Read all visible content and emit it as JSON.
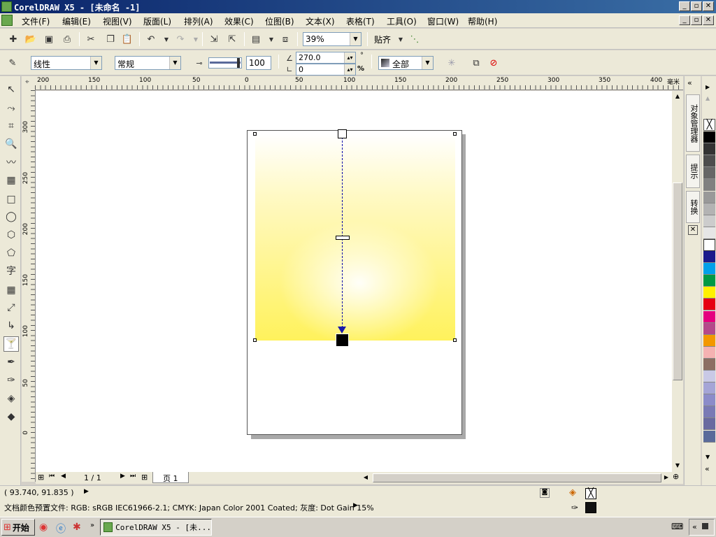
{
  "titlebar": {
    "title": "CorelDRAW X5 - [未命名 -1]"
  },
  "menu": [
    "文件(F)",
    "编辑(E)",
    "视图(V)",
    "版面(L)",
    "排列(A)",
    "效果(C)",
    "位图(B)",
    "文本(X)",
    "表格(T)",
    "工具(O)",
    "窗口(W)",
    "帮助(H)"
  ],
  "toolbar": {
    "zoom": "39%",
    "snap_label": "贴齐"
  },
  "propbar": {
    "fill_type": "线性",
    "fill_mode": "常规",
    "opacity": "100",
    "angle": "270.0",
    "edge_pad": "0",
    "apply_to": "全部"
  },
  "ruler": {
    "h_ticks": [
      "200",
      "150",
      "100",
      "50",
      "0",
      "50",
      "100",
      "150",
      "200",
      "250",
      "300",
      "350",
      "400"
    ],
    "h_unit": "毫米",
    "v_ticks": [
      "300",
      "250",
      "200",
      "150",
      "100",
      "50",
      "0"
    ]
  },
  "pagenav": {
    "page_count": "1 / 1",
    "page_tab": "页 1"
  },
  "status": {
    "coords": "( 93.740, 91.835 )",
    "color_profile": "文档颜色预置文件: RGB: sRGB IEC61966-2.1; CMYK: Japan Color 2001 Coated; 灰度: Dot Gain 15%"
  },
  "docker": {
    "tabs": [
      "对象管理器",
      "提示",
      "转换"
    ]
  },
  "palette": {
    "colors": [
      "#000000",
      "#333333",
      "#4d4d4d",
      "#666666",
      "#808080",
      "#999999",
      "#b3b3b3",
      "#cccccc",
      "#e6e6e6",
      "#ffffff",
      "#1a1a8c",
      "#00a0e9",
      "#009944",
      "#fff100",
      "#e60012",
      "#e4007f",
      "#b5488b",
      "#f39800",
      "#f5b2b2",
      "#8c6e63",
      "#c9c9e6",
      "#a5a5d6",
      "#8c8cc9",
      "#7a7ab5",
      "#6a6aa0",
      "#5a6a9a"
    ]
  },
  "taskbar": {
    "start_label": "开始",
    "app_task": "CorelDRAW X5 - [未..."
  }
}
